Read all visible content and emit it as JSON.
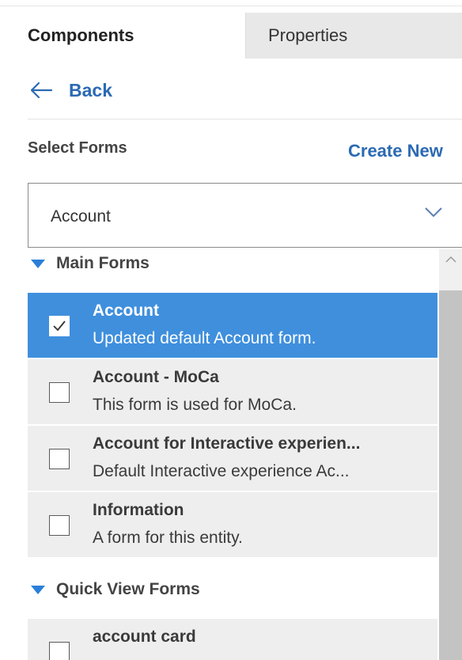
{
  "tabs": {
    "components": "Components",
    "properties": "Properties"
  },
  "nav": {
    "back_label": "Back"
  },
  "select_forms": {
    "label": "Select Forms",
    "create_new": "Create New",
    "selected_entity": "Account"
  },
  "groups": {
    "main_forms": "Main Forms",
    "quick_view_forms": "Quick View Forms"
  },
  "main_forms": [
    {
      "title": "Account",
      "description": "Updated default Account form.",
      "checked": true
    },
    {
      "title": "Account - MoCa",
      "description": "This form is used for MoCa.",
      "checked": false
    },
    {
      "title": "Account for Interactive experien...",
      "description": "Default Interactive experience Ac...",
      "checked": false
    },
    {
      "title": "Information",
      "description": "A form for this entity.",
      "checked": false
    }
  ],
  "quick_view_forms": [
    {
      "title": "account card",
      "description": "",
      "checked": false
    }
  ],
  "colors": {
    "accent": "#2b6ab3",
    "selected_bg": "#3f8fdd",
    "item_bg": "#eeeeee"
  }
}
